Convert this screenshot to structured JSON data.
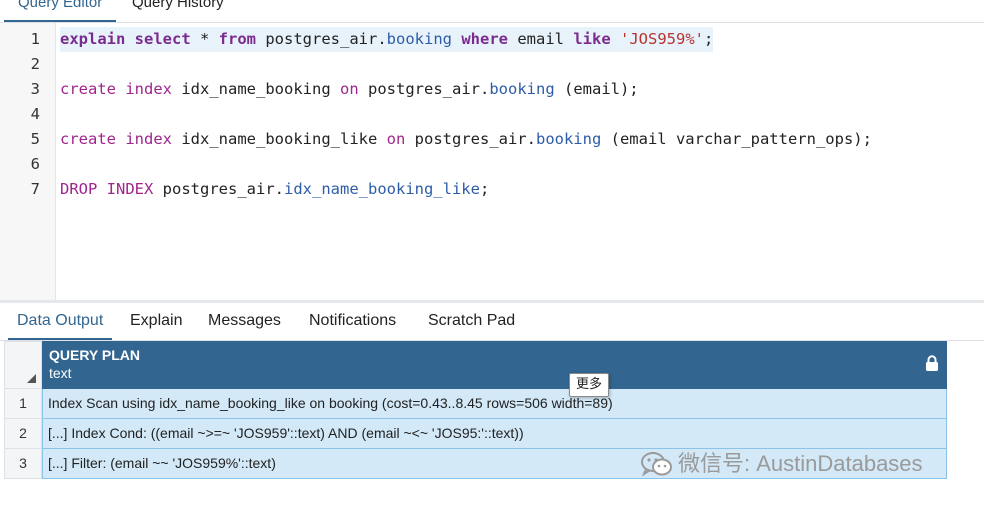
{
  "top_tabs": [
    {
      "label": "Query Editor",
      "active": true
    },
    {
      "label": "Query History",
      "active": false
    }
  ],
  "editor": {
    "lines": [
      {
        "num": "1",
        "highlighted": true,
        "tokens": [
          {
            "t": "explain",
            "c": "kw"
          },
          {
            "t": " ",
            "c": "plain"
          },
          {
            "t": "select",
            "c": "kw"
          },
          {
            "t": " * ",
            "c": "plain"
          },
          {
            "t": "from",
            "c": "kw"
          },
          {
            "t": " postgres_air.",
            "c": "plain"
          },
          {
            "t": "booking",
            "c": "prop"
          },
          {
            "t": " ",
            "c": "plain"
          },
          {
            "t": "where",
            "c": "kw"
          },
          {
            "t": " email ",
            "c": "plain"
          },
          {
            "t": "like",
            "c": "kw"
          },
          {
            "t": " ",
            "c": "plain"
          },
          {
            "t": "'JOS959%'",
            "c": "str"
          },
          {
            "t": ";",
            "c": "plain"
          }
        ]
      },
      {
        "num": "2",
        "highlighted": false,
        "tokens": []
      },
      {
        "num": "3",
        "highlighted": false,
        "tokens": [
          {
            "t": "create",
            "c": "kw2"
          },
          {
            "t": " ",
            "c": "plain"
          },
          {
            "t": "index",
            "c": "kw2"
          },
          {
            "t": " idx_name_booking ",
            "c": "plain"
          },
          {
            "t": "on",
            "c": "kw2"
          },
          {
            "t": " postgres_air.",
            "c": "plain"
          },
          {
            "t": "booking",
            "c": "prop"
          },
          {
            "t": " (email);",
            "c": "plain"
          }
        ]
      },
      {
        "num": "4",
        "highlighted": false,
        "tokens": []
      },
      {
        "num": "5",
        "highlighted": false,
        "tokens": [
          {
            "t": "create",
            "c": "kw2"
          },
          {
            "t": " ",
            "c": "plain"
          },
          {
            "t": "index",
            "c": "kw2"
          },
          {
            "t": " idx_name_booking_like ",
            "c": "plain"
          },
          {
            "t": "on",
            "c": "kw2"
          },
          {
            "t": " postgres_air.",
            "c": "plain"
          },
          {
            "t": "booking",
            "c": "prop"
          },
          {
            "t": " (email varchar_pattern_ops);",
            "c": "plain"
          }
        ]
      },
      {
        "num": "6",
        "highlighted": false,
        "tokens": []
      },
      {
        "num": "7",
        "highlighted": false,
        "tokens": [
          {
            "t": "DROP",
            "c": "kw2"
          },
          {
            "t": " ",
            "c": "plain"
          },
          {
            "t": "INDEX",
            "c": "kw2"
          },
          {
            "t": " postgres_air.",
            "c": "plain"
          },
          {
            "t": "idx_name_booking_like",
            "c": "prop"
          },
          {
            "t": ";",
            "c": "plain"
          }
        ]
      }
    ]
  },
  "output_tabs": [
    {
      "label": "Data Output",
      "active": true
    },
    {
      "label": "Explain",
      "active": false
    },
    {
      "label": "Messages",
      "active": false
    },
    {
      "label": "Notifications",
      "active": false
    },
    {
      "label": "Scratch Pad",
      "active": false
    }
  ],
  "grid": {
    "column": {
      "name": "QUERY PLAN",
      "type": "text",
      "icon": "lock-icon"
    },
    "rows": [
      {
        "num": "1",
        "value": "Index Scan using idx_name_booking_like on booking  (cost=0.43..8.45 rows=506 width=89)"
      },
      {
        "num": "2",
        "value": "[...] Index Cond: ((email ~>=~ 'JOS959'::text) AND (email ~<~ 'JOS95:'::text))"
      },
      {
        "num": "3",
        "value": "[...] Filter: (email ~~ 'JOS959%'::text)"
      }
    ]
  },
  "tooltip": {
    "label": "更多"
  },
  "watermark": {
    "text": "微信号: AustinDatabases",
    "icon": "wechat-icon"
  },
  "colors": {
    "accent": "#326690",
    "header_bg": "#326690",
    "row_bg": "#d3e9f8",
    "row_border": "#8cc3e8",
    "keyword": "#7a2c8e",
    "string": "#b8332f",
    "property": "#2d5da8"
  }
}
